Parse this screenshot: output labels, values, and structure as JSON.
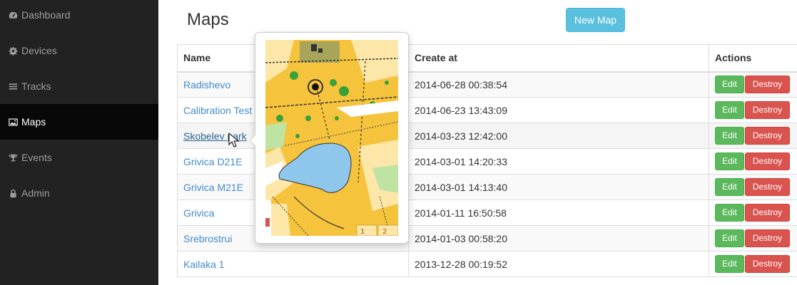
{
  "sidebar": {
    "items": [
      {
        "label": "Dashboard",
        "icon": "dashboard-icon",
        "active": false
      },
      {
        "label": "Devices",
        "icon": "gear-icon",
        "active": false
      },
      {
        "label": "Tracks",
        "icon": "list-icon",
        "active": false
      },
      {
        "label": "Maps",
        "icon": "picture-icon",
        "active": true
      },
      {
        "label": "Events",
        "icon": "trophy-icon",
        "active": false
      },
      {
        "label": "Admin",
        "icon": "lock-icon",
        "active": false
      }
    ]
  },
  "page": {
    "title": "Maps",
    "new_button": "New Map"
  },
  "table": {
    "headers": {
      "name": "Name",
      "created": "Create at",
      "actions": "Actions"
    },
    "edit_label": "Edit",
    "destroy_label": "Destroy",
    "rows": [
      {
        "name": "Radishevo",
        "created": "2014-06-28 00:38:54"
      },
      {
        "name": "Calibration Test",
        "created": "2014-06-23 13:43:09"
      },
      {
        "name": "Skobelev park",
        "created": "2014-03-23 12:42:00"
      },
      {
        "name": "Grivica D21E",
        "created": "2014-03-01 14:20:33"
      },
      {
        "name": "Grivica M21E",
        "created": "2014-03-01 14:13:40"
      },
      {
        "name": "Grivica",
        "created": "2014-01-11 16:50:58"
      },
      {
        "name": "Srebrostrui",
        "created": "2014-01-03 00:58:20"
      },
      {
        "name": "Kailaka 1",
        "created": "2013-12-28 00:19:52"
      }
    ]
  },
  "popover": {
    "image": "map-preview",
    "marks": [
      "1",
      "2"
    ]
  },
  "colors": {
    "sidebar_bg": "#222222",
    "sidebar_active": "#080808",
    "info": "#5bc0de",
    "success": "#5cb85c",
    "danger": "#d9534f",
    "link": "#428bca"
  }
}
